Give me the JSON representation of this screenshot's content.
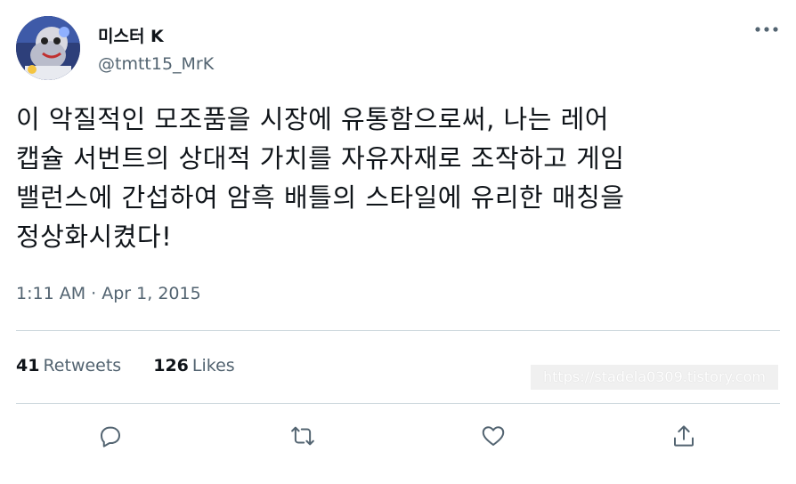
{
  "user": {
    "display_name": "미스터 K",
    "handle": "@tmtt15_MrK"
  },
  "tweet": {
    "lines": [
      "이 악질적인 모조품을 시장에 유통함으로써, 나는 레어",
      "캡슐 서번트의 상대적 가치를 자유자재로 조작하고 게임",
      "밸런스에 간섭하여 암흑 배틀의 스타일에 유리한 매칭을",
      "정상화시켰다!"
    ],
    "time": "1:11 AM",
    "separator": "·",
    "date": "Apr 1, 2015"
  },
  "stats": {
    "retweets_count": "41",
    "retweets_label": "Retweets",
    "likes_count": "126",
    "likes_label": "Likes"
  },
  "watermark": "https://stadela0309.tistory.com",
  "icons": {
    "more": "more-horizontal-icon",
    "reply": "reply-icon",
    "retweet": "retweet-icon",
    "like": "heart-icon",
    "share": "share-icon"
  },
  "colors": {
    "text": "#0f1419",
    "secondary": "#536471",
    "divider": "#cfd9de"
  }
}
